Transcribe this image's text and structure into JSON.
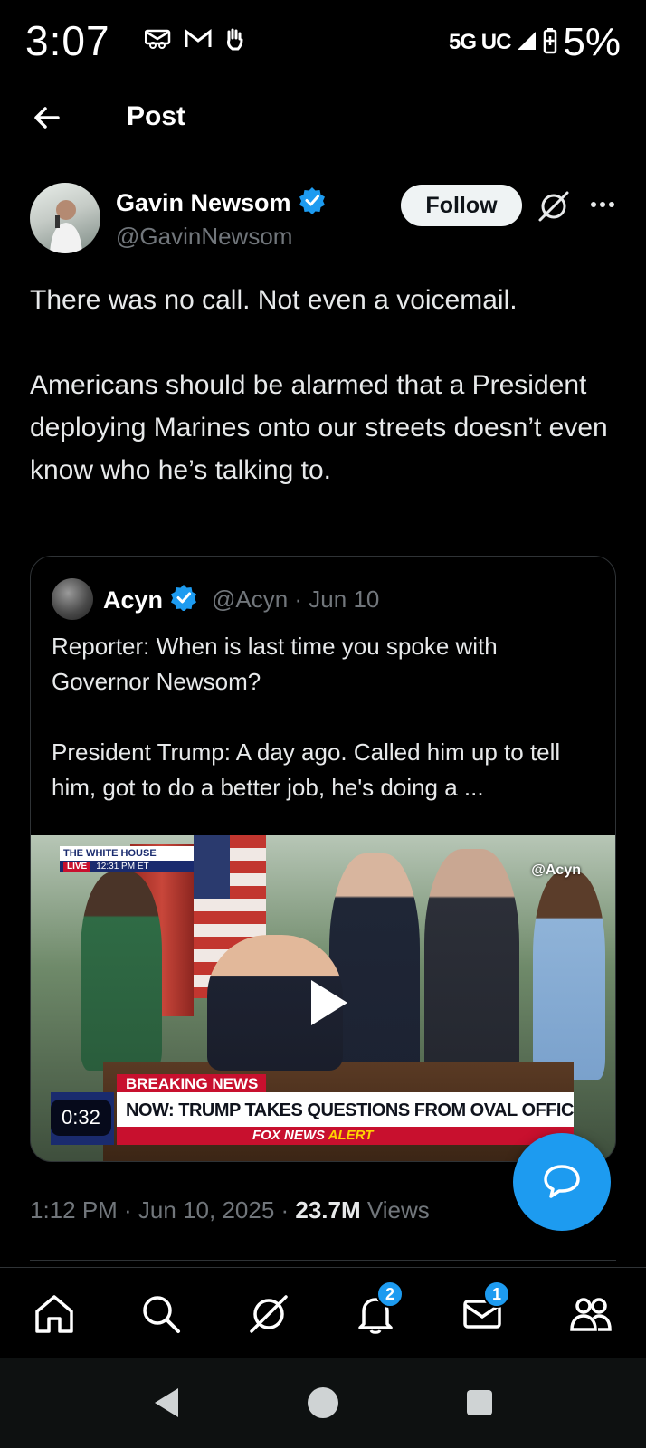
{
  "status_bar": {
    "time": "3:07",
    "network": "5G UC",
    "battery": "5%",
    "icons_left": [
      "voicemail-icon",
      "gmail-icon",
      "hand-icon"
    ]
  },
  "header": {
    "title": "Post"
  },
  "post": {
    "author_name": "Gavin Newsom",
    "author_handle": "@GavinNewsom",
    "follow_label": "Follow",
    "text_line1": "There was no call. Not even a voicemail.",
    "text_line2": "Americans should be alarmed that a President deploying Marines onto our streets doesn’t even know who he’s talking to.",
    "timestamp": "1:12 PM · Jun 10, 2025 · ",
    "views_count": "23.7M",
    "views_label": " Views"
  },
  "quote": {
    "author_name": "Acyn",
    "author_handle_date": "@Acyn · Jun 10",
    "text_line1": "Reporter: When is last time you spoke with Governor Newsom?",
    "text_line2": "President Trump: A day ago. Called him up to tell him, got to do a better job, he's doing a ...",
    "video": {
      "duration": "0:32",
      "overlay_wh_top": "THE WHITE HOUSE",
      "overlay_live": "LIVE",
      "overlay_time": "12:31 PM ET",
      "overlay_watermark": "@Acyn",
      "ticker_breaking": "BREAKING NEWS",
      "ticker_headline": "NOW: TRUMP TAKES QUESTIONS FROM OVAL OFFICE",
      "ticker_alert_fox": "FOX NEWS",
      "ticker_alert_word": "ALERT"
    }
  },
  "bottom_nav": {
    "notifications_badge": "2",
    "messages_badge": "1"
  },
  "colors": {
    "accent": "#1d9bf0",
    "background": "#000000",
    "text_primary": "#e7e9ea",
    "text_secondary": "#71767b"
  }
}
